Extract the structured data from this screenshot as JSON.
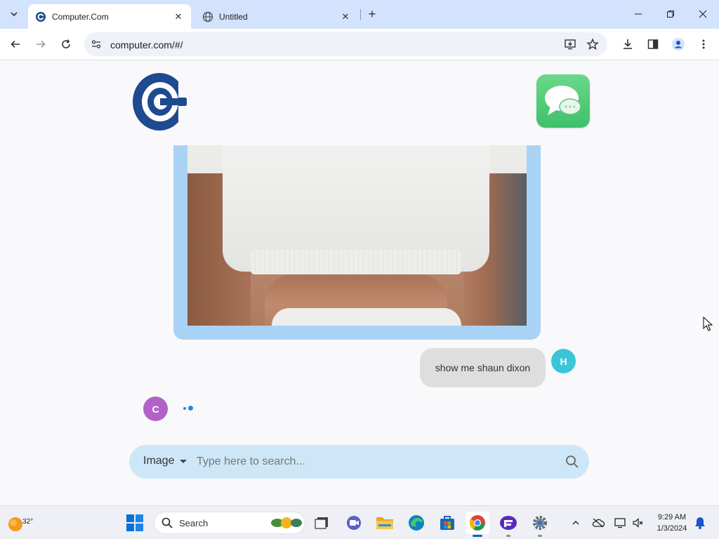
{
  "browser": {
    "tabs": [
      {
        "title": "Computer.Com",
        "active": true
      },
      {
        "title": "Untitled",
        "active": false
      }
    ],
    "address": "computer.com/#/"
  },
  "chat": {
    "user_message": "show me shaun dixon",
    "user_avatar_letter": "H",
    "bot_avatar_letter": "C"
  },
  "search": {
    "mode": "Image",
    "placeholder": "Type here to search..."
  },
  "taskbar": {
    "temperature": "32°",
    "search_label": "Search",
    "time": "9:29 AM",
    "date": "1/3/2024"
  },
  "colors": {
    "tabstrip": "#d3e3fd",
    "image_frame": "#a9d3f5",
    "search_bar": "#cde7f8",
    "user_avatar": "#3cc5d6",
    "bot_avatar": "#b062c8",
    "logo_blue": "#1e4a8f",
    "messages_green": "#4cc874"
  }
}
